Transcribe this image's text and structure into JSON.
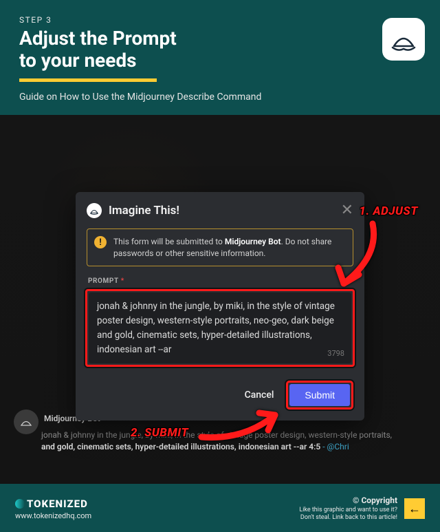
{
  "header": {
    "step": "STEP 3",
    "title_line1": "Adjust the Prompt",
    "title_line2": "to your needs",
    "subtitle": "Guide on How to Use the Midjourney Describe Command"
  },
  "modal": {
    "title": "Imagine This!",
    "warning_pre": "This form will be submitted to ",
    "warning_bold": "Midjourney Bot",
    "warning_post": ". Do not share passwords or other sensitive information.",
    "field_label": "PROMPT",
    "prompt_value": "jonah & johnny in the jungle, by miki, in the style of vintage poster design, western-style portraits, neo-geo, dark beige and gold, cinematic sets, hyper-detailed illustrations, indonesian art --ar",
    "char_count": "3798",
    "cancel": "Cancel",
    "submit": "Submit"
  },
  "annotations": {
    "a1": "1. ADJUST",
    "a2": "2. SUBMIT"
  },
  "background": {
    "bot_name": "Midjourney Bot",
    "line1_prefix": "jonah & johnny in the jungle, by miki, in the style of vintage poster design, western-style portraits,",
    "line2": "and gold, cinematic sets, hyper-detailed illustrations, indonesian art --ar 4:5",
    "mention": " - @Chri"
  },
  "footer": {
    "brand": "TOKENIZED",
    "url": "www.tokenizedhq.com",
    "copyright": "© Copyright",
    "copy_line1": "Like this graphic and want to use it?",
    "copy_line2": "Don't steal. Link back to this article!",
    "back_arrow": "←"
  }
}
